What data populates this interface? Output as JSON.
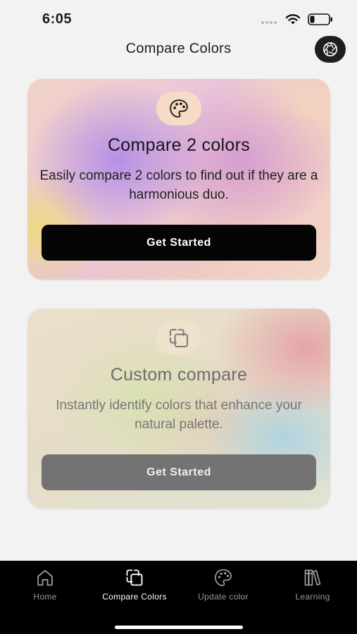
{
  "status_bar": {
    "time": "6:05"
  },
  "header": {
    "title": "Compare Colors",
    "settings_icon": "aperture-icon"
  },
  "cards": [
    {
      "icon": "palette-icon",
      "title": "Compare 2 colors",
      "description": "Easily compare 2 colors to find out if they are a harmonious duo.",
      "button_label": "Get Started"
    },
    {
      "icon": "compare-frames-icon",
      "title": "Custom compare",
      "description": "Instantly identify colors that enhance your natural palette.",
      "button_label": "Get Started"
    }
  ],
  "tab_bar": {
    "active": "Compare Colors",
    "tabs": [
      {
        "label": "Home",
        "icon": "home-icon"
      },
      {
        "label": "Compare Colors",
        "icon": "compare-frames-icon"
      },
      {
        "label": "Update color",
        "icon": "palette-icon"
      },
      {
        "label": "Learning",
        "icon": "books-icon"
      }
    ]
  },
  "colors": {
    "background": "#f2f2f2",
    "primary_button": "#050505",
    "secondary_button": "#737373",
    "tab_bar": "#000000",
    "tab_active_label": "#ffffff",
    "tab_inactive_label": "#9a9a9a"
  }
}
